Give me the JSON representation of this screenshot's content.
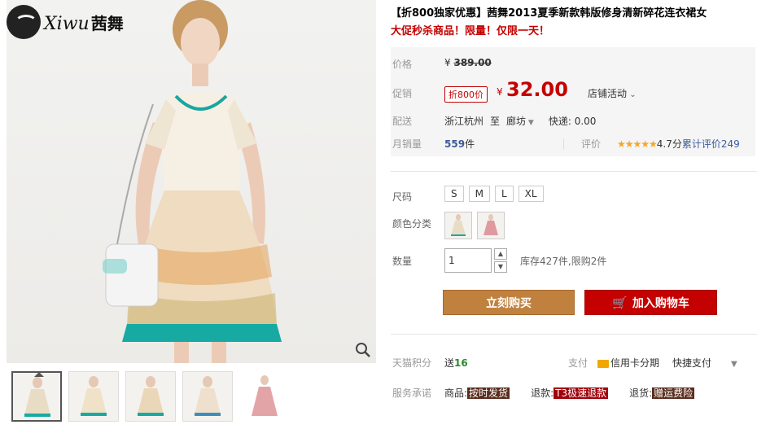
{
  "brand": {
    "name_latin": "Xiwu",
    "name_cn": "茜舞"
  },
  "product": {
    "title": "【折800独家优惠】茜舞2013夏季新款韩版修身清新碎花连衣裙女",
    "promo": "大促秒杀商品！限量！仅限一天！"
  },
  "price": {
    "label": "价格",
    "currency": "¥",
    "original": "389.00"
  },
  "promotion": {
    "label": "促销",
    "tag": "折800价",
    "currency": "¥",
    "value": "32.00",
    "shop_activity": "店铺活动"
  },
  "shipping": {
    "label": "配送",
    "from": "浙江杭州",
    "to_word": "至",
    "to": "廊坊",
    "fee": "快递: 0.00"
  },
  "sales": {
    "label": "月销量",
    "count": "559",
    "unit": "件",
    "rating_label": "评价",
    "stars": "★★★★★",
    "score": "4.7分",
    "reviews": "累计评价249"
  },
  "sku": {
    "size_label": "尺码",
    "sizes": [
      "S",
      "M",
      "L",
      "XL"
    ],
    "color_label": "颜色分类",
    "qty_label": "数量",
    "qty_value": "1",
    "stock": "库存427件,限购2件"
  },
  "actions": {
    "buy_now": "立刻购买",
    "add_to_cart": "加入购物车"
  },
  "points": {
    "label": "天猫积分",
    "prefix": "送",
    "value": "16"
  },
  "payment": {
    "label": "支付",
    "card": "信用卡分期",
    "quick": "快捷支付"
  },
  "service": {
    "label": "服务承诺",
    "items": [
      {
        "prefix": "商品:",
        "badge": "按时发货"
      },
      {
        "prefix": "退款:",
        "badge": "T3极速退款"
      },
      {
        "prefix": "退货:",
        "badge": "赠运费险"
      }
    ]
  },
  "colors": {
    "accent_red": "#c40000",
    "buy_orange": "#c0813f",
    "link_blue": "#3c5a99"
  }
}
